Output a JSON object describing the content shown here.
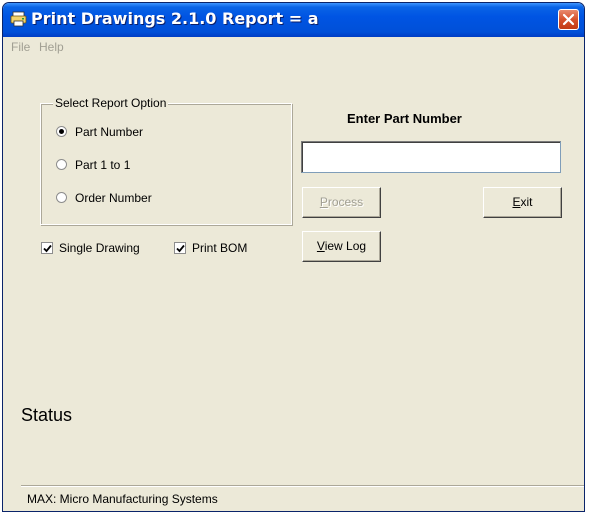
{
  "window": {
    "title": "Print Drawings 2.1.0 Report = a",
    "icon": "printer-icon",
    "close_icon": "close-icon"
  },
  "menu": {
    "items": [
      {
        "label": "File"
      },
      {
        "label": "Help"
      }
    ]
  },
  "report_option": {
    "group_label": "Select Report Option",
    "options": [
      {
        "label": "Part Number",
        "checked": true
      },
      {
        "label": "Part 1 to 1",
        "checked": false
      },
      {
        "label": "Order Number",
        "checked": false
      }
    ]
  },
  "checkboxes": [
    {
      "label": "Single Drawing",
      "checked": true
    },
    {
      "label": "Print BOM",
      "checked": true
    }
  ],
  "part_entry": {
    "label": "Enter Part Number",
    "value": "",
    "placeholder": ""
  },
  "buttons": {
    "process": {
      "label_underlined": "P",
      "label_rest": "rocess",
      "enabled": false
    },
    "exit": {
      "label_underlined": "E",
      "label_rest": "xit",
      "enabled": true
    },
    "view_log": {
      "label_underlined": "V",
      "label_rest": "iew Log",
      "enabled": true
    }
  },
  "status": {
    "label": "Status"
  },
  "statusbar": {
    "text": "MAX: Micro Manufacturing Systems"
  },
  "colors": {
    "titlebar": "#0054e3",
    "window_bg": "#ece9d8",
    "disabled_text": "#a19f93",
    "close_button": "#d6512c"
  }
}
